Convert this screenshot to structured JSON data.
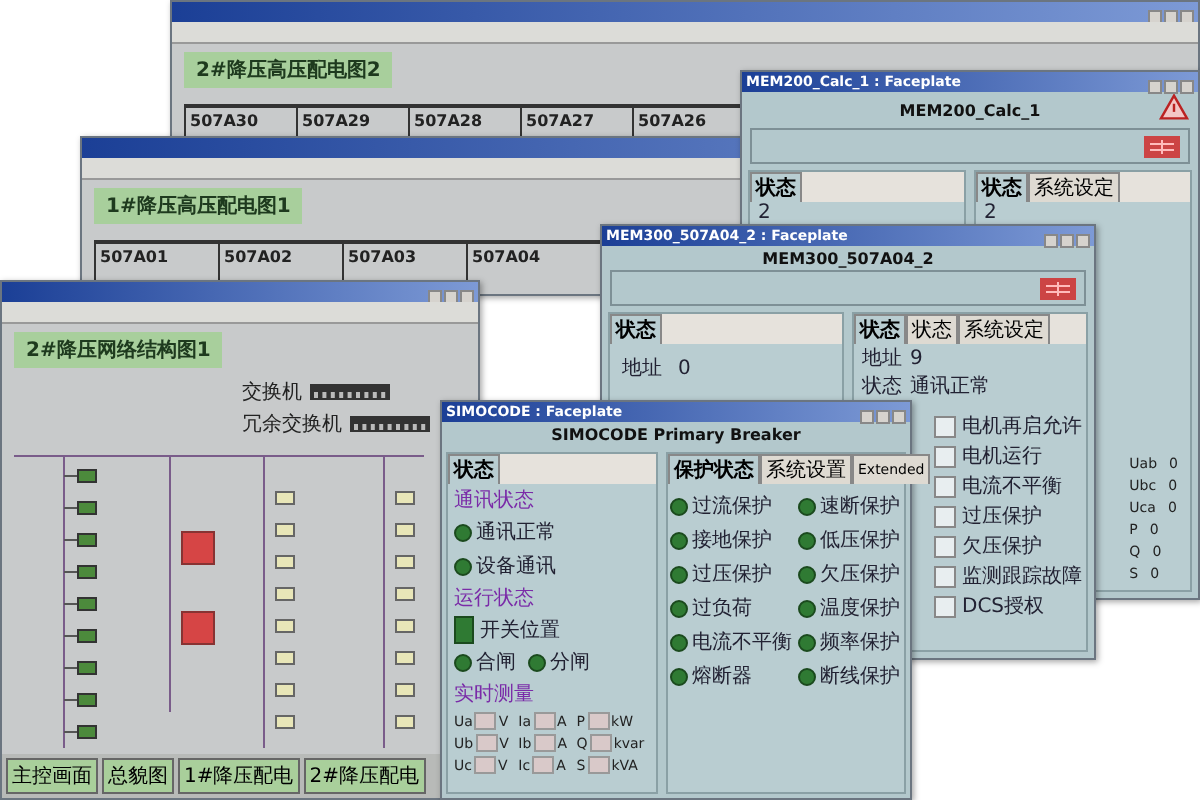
{
  "diagram_windows": [
    {
      "header": "2#降压高压配电图2",
      "feeders": [
        "507A30",
        "507A29",
        "507A28",
        "507A27",
        "507A26"
      ]
    },
    {
      "header": "1#降压高压配电图1",
      "feeders": [
        "507A01",
        "507A02",
        "507A03",
        "507A04"
      ]
    }
  ],
  "network_window": {
    "header": "2#降压网络结构图1",
    "switches": [
      "交换机",
      "冗余交换机"
    ],
    "nav_buttons": [
      "主控画面",
      "总貌图",
      "1#降压配电",
      "2#降压配电"
    ]
  },
  "calc_faceplate": {
    "title": "MEM200_Calc_1 : Faceplate",
    "heading": "MEM200_Calc_1",
    "left_tabs": [
      {
        "label": "状态",
        "selected": true
      }
    ],
    "right_tabs": [
      {
        "label": "状态",
        "selected": true
      },
      {
        "label": "系统设定",
        "selected": false
      }
    ],
    "left_value": "2",
    "right_value": "2",
    "readings": [
      {
        "label": "Uab",
        "value": "0"
      },
      {
        "label": "Ubc",
        "value": "0"
      },
      {
        "label": "Uca",
        "value": "0"
      },
      {
        "label": "P",
        "value": "0"
      },
      {
        "label": "Q",
        "value": "0"
      },
      {
        "label": "S",
        "value": "0"
      }
    ]
  },
  "mem_faceplate": {
    "title": "MEM300_507A04_2 : Faceplate",
    "heading": "MEM300_507A04_2",
    "left_tabs": [
      {
        "label": "状态",
        "selected": true
      }
    ],
    "right_tabs": [
      {
        "label": "状态",
        "selected": true
      },
      {
        "label": "状态",
        "selected": false
      },
      {
        "label": "系统设定",
        "selected": false
      }
    ],
    "left_fields": [
      {
        "label": "地址",
        "value": "0"
      }
    ],
    "right_fields": [
      {
        "label": "地址",
        "value": "9"
      },
      {
        "label": "状态",
        "value": "通讯正常"
      }
    ],
    "checks": [
      {
        "label": "电机再启允许",
        "checked": false
      },
      {
        "label": "电机运行",
        "checked": false
      },
      {
        "label": "电流不平衡",
        "checked": false
      },
      {
        "label": "过压保护",
        "checked": false
      },
      {
        "label": "欠压保护",
        "checked": false
      },
      {
        "label": "监测跟踪故障",
        "checked": false
      },
      {
        "label": "DCS授权",
        "checked": false
      }
    ]
  },
  "simocode_faceplate": {
    "title": "SIMOCODE : Faceplate",
    "heading": "SIMOCODE Primary Breaker",
    "left_tabs": [
      {
        "label": "状态",
        "selected": true
      }
    ],
    "right_tabs": [
      {
        "label": "保护状态",
        "selected": true
      },
      {
        "label": "系统设置",
        "selected": false
      },
      {
        "label": "Extended",
        "selected": false
      }
    ],
    "comm_title": "通讯状态",
    "comm_lamps": [
      "通讯正常",
      "设备通讯"
    ],
    "run_title": "运行状态",
    "switch_label": "开关位置",
    "run_lamps": [
      "合闸",
      "分闸"
    ],
    "measure_title": "实时测量",
    "measures": [
      {
        "label": "Ua",
        "unit": "V"
      },
      {
        "label": "Ia",
        "unit": "A"
      },
      {
        "label": "P",
        "unit": "kW"
      },
      {
        "label": "Ub",
        "unit": "V"
      },
      {
        "label": "Ib",
        "unit": "A"
      },
      {
        "label": "Q",
        "unit": "kvar"
      },
      {
        "label": "Uc",
        "unit": "V"
      },
      {
        "label": "Ic",
        "unit": "A"
      },
      {
        "label": "S",
        "unit": "kVA"
      }
    ],
    "protection_lamps": [
      "过流保护",
      "速断保护",
      "接地保护",
      "低压保护",
      "过压保护",
      "欠压保护",
      "过负荷",
      "温度保护",
      "电流不平衡",
      "频率保护",
      "熔断器",
      "断线保护"
    ]
  }
}
